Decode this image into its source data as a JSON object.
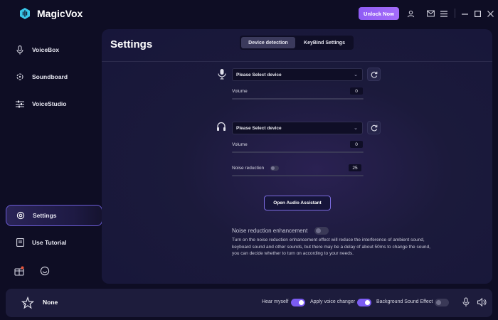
{
  "app": {
    "name": "MagicVox",
    "unlock_label": "Unlock Now",
    "accent_color": "#8f5cf5"
  },
  "titlebar": {
    "icons": [
      "user-icon",
      "mail-icon",
      "menu-icon",
      "minimize-icon",
      "maximize-icon",
      "close-icon"
    ]
  },
  "sidebar": {
    "items": [
      {
        "label": "VoiceBox",
        "icon": "microphone-icon"
      },
      {
        "label": "Soundboard",
        "icon": "soundboard-icon"
      },
      {
        "label": "VoiceStudio",
        "icon": "sliders-icon"
      },
      {
        "label": "Settings",
        "icon": "settings-icon",
        "active": true
      },
      {
        "label": "Use Tutorial",
        "icon": "book-icon"
      }
    ],
    "bottom_icons": [
      "gift-icon",
      "chat-icon"
    ]
  },
  "settings": {
    "title": "Settings",
    "tabs": [
      {
        "label": "Device detection",
        "active": true
      },
      {
        "label": "KeyBind Settings",
        "active": false
      }
    ],
    "input_device": {
      "placeholder": "Please Select device",
      "volume_label": "Volume",
      "volume_value": "0"
    },
    "output_device": {
      "placeholder": "Please Select device",
      "volume_label": "Volume",
      "volume_value": "0",
      "noise_label": "Noise reduction",
      "noise_value": "25"
    },
    "assistant_button": "Open Audio Assistant",
    "noise_enhancement": {
      "label": "Noise reduction enhancement",
      "enabled": false,
      "description": "Turn on the noise reduction enhancement effect will reduce the interference of ambient sound, keyboard sound and other sounds, but there may be a delay of about 50ms to change the sound, you can decide whether to turn on according to your needs."
    }
  },
  "footer": {
    "voice_name": "None",
    "hear_myself_label": "Hear myself",
    "hear_myself_on": true,
    "apply_changer_label": "Apply voice changer",
    "apply_changer_on": true,
    "background_effect_label": "Background Sound Effect",
    "background_effect_on": false
  }
}
